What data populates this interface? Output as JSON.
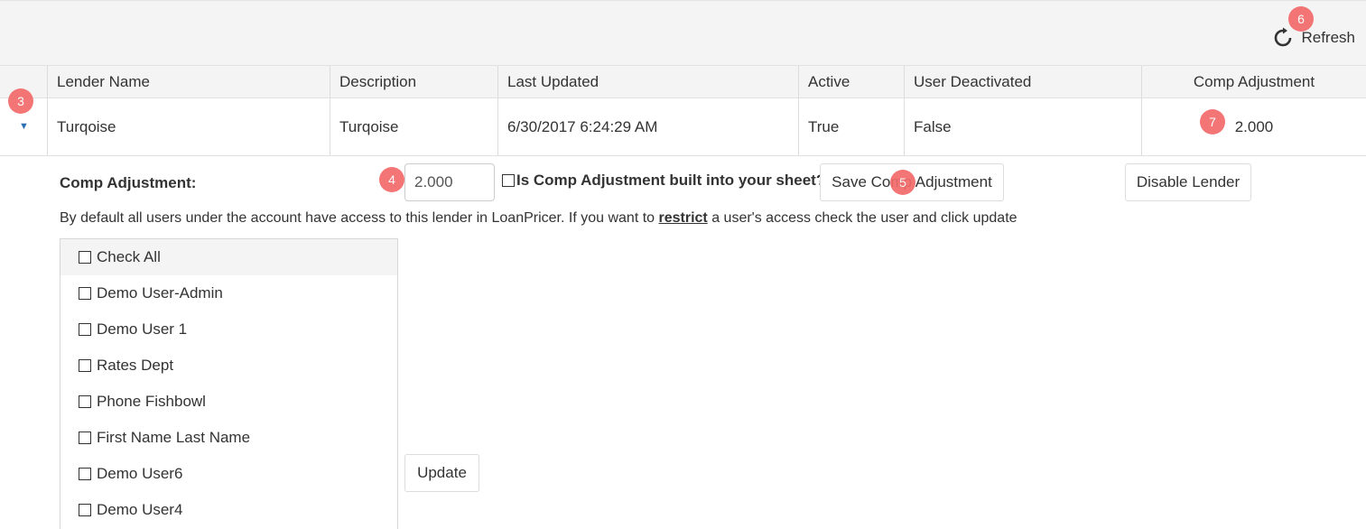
{
  "toolbar": {
    "refresh_label": "Refresh"
  },
  "grid": {
    "columns": [
      "Lender Name",
      "Description",
      "Last Updated",
      "Active",
      "User Deactivated",
      "Comp Adjustment"
    ],
    "row": {
      "lender_name": "Turqoise",
      "description": "Turqoise",
      "last_updated": "6/30/2017 6:24:29 AM",
      "active": "True",
      "user_deactivated": "False",
      "comp_adjustment": "2.000"
    }
  },
  "detail": {
    "comp_label": "Comp Adjustment:",
    "comp_value": "2.000",
    "built_in_label": "Is Comp Adjustment built into your sheet?",
    "save_button": "Save Comp Adjustment",
    "disable_button": "Disable Lender",
    "default_text_before": "By default all users under the account have access to this lender in LoanPricer. If you want to ",
    "default_text_emph": "restrict",
    "default_text_after": " a user's access check the user and click update",
    "users": [
      "Check All",
      "Demo User-Admin",
      "Demo User 1",
      "Rates Dept",
      "Phone Fishbowl",
      "First Name Last Name",
      "Demo User6",
      "Demo User4"
    ],
    "update_button": "Update"
  },
  "badges": {
    "b3": "3",
    "b4": "4",
    "b5": "5",
    "b6": "6",
    "b7": "7"
  },
  "colors": {
    "badge": "#f26a6a",
    "header_bg": "#f4f4f4",
    "arrow": "#2c6fb5"
  }
}
